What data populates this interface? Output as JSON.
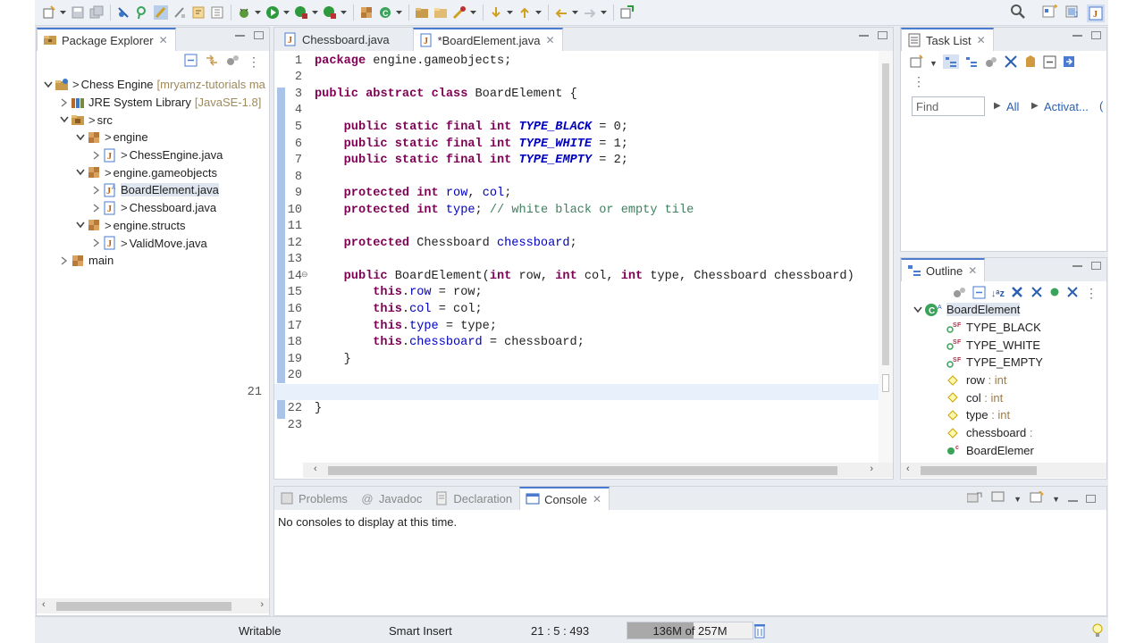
{
  "colors": {
    "accent": "#4a7bd0",
    "keyword": "#7f0055",
    "field": "#0000c0",
    "comment": "#3f7f5f"
  },
  "toolbar": {
    "icons": [
      "new-icon",
      "save-icon",
      "save-all-icon",
      "skip-breakpoints-icon",
      "toggle-mark-occurrences-icon",
      "highlight-icon",
      "block-selection-icon",
      "word-wrap-icon",
      "show-whitespace-icon",
      "debug-icon",
      "run-icon",
      "coverage-icon",
      "external-tools-icon",
      "new-java-package-icon",
      "new-java-class-icon",
      "open-type-icon",
      "open-task-icon",
      "search-icon",
      "next-annotation-icon",
      "previous-annotation-icon",
      "back-icon",
      "forward-icon",
      "pin-editor-icon"
    ]
  },
  "package_explorer": {
    "title": "Package Explorer",
    "tree": [
      {
        "label": "Chess Engine",
        "extra": "[mryamz-tutorials ma",
        "prefix": ">",
        "depth": 0,
        "arrow": "down",
        "icon": "project-icon"
      },
      {
        "label": "JRE System Library",
        "extra": "[JavaSE-1.8]",
        "prefix": "",
        "depth": 1,
        "arrow": "right",
        "icon": "library-icon"
      },
      {
        "label": "src",
        "extra": "",
        "prefix": ">",
        "depth": 1,
        "arrow": "down",
        "icon": "source-folder-icon"
      },
      {
        "label": "engine",
        "extra": "",
        "prefix": ">",
        "depth": 2,
        "arrow": "down",
        "icon": "package-icon"
      },
      {
        "label": "ChessEngine.java",
        "extra": "",
        "prefix": ">",
        "depth": 3,
        "arrow": "right",
        "icon": "java-file-icon"
      },
      {
        "label": "engine.gameobjects",
        "extra": "",
        "prefix": ">",
        "depth": 2,
        "arrow": "down",
        "icon": "package-icon"
      },
      {
        "label": "BoardElement.java",
        "extra": "",
        "prefix": "",
        "depth": 3,
        "arrow": "right",
        "icon": "java-abstract-file-icon",
        "selected": true
      },
      {
        "label": "Chessboard.java",
        "extra": "",
        "prefix": ">",
        "depth": 3,
        "arrow": "right",
        "icon": "java-file-icon"
      },
      {
        "label": "engine.structs",
        "extra": "",
        "prefix": ">",
        "depth": 2,
        "arrow": "down",
        "icon": "package-icon"
      },
      {
        "label": "ValidMove.java",
        "extra": "",
        "prefix": ">",
        "depth": 3,
        "arrow": "right",
        "icon": "java-file-icon"
      },
      {
        "label": "main",
        "extra": "",
        "prefix": "",
        "depth": 1,
        "arrow": "right",
        "icon": "package-icon"
      }
    ]
  },
  "editor": {
    "tabs": [
      {
        "label": "Chessboard.java",
        "active": false
      },
      {
        "label": "*BoardElement.java",
        "active": true
      }
    ],
    "current_line": 21,
    "lines": [
      [
        [
          "kw",
          "package"
        ],
        [
          "t",
          " engine.gameobjects;"
        ]
      ],
      [],
      [
        [
          "kw",
          "public"
        ],
        [
          "t",
          " "
        ],
        [
          "kw",
          "abstract"
        ],
        [
          "t",
          " "
        ],
        [
          "kw",
          "class"
        ],
        [
          "t",
          " BoardElement {"
        ]
      ],
      [],
      [
        [
          "t",
          "    "
        ],
        [
          "kw",
          "public"
        ],
        [
          "t",
          " "
        ],
        [
          "kw",
          "static"
        ],
        [
          "t",
          " "
        ],
        [
          "kw",
          "final"
        ],
        [
          "t",
          " "
        ],
        [
          "kw",
          "int"
        ],
        [
          "t",
          " "
        ],
        [
          "cst",
          "TYPE_BLACK"
        ],
        [
          "t",
          " = 0;"
        ]
      ],
      [
        [
          "t",
          "    "
        ],
        [
          "kw",
          "public"
        ],
        [
          "t",
          " "
        ],
        [
          "kw",
          "static"
        ],
        [
          "t",
          " "
        ],
        [
          "kw",
          "final"
        ],
        [
          "t",
          " "
        ],
        [
          "kw",
          "int"
        ],
        [
          "t",
          " "
        ],
        [
          "cst",
          "TYPE_WHITE"
        ],
        [
          "t",
          " = 1;"
        ]
      ],
      [
        [
          "t",
          "    "
        ],
        [
          "kw",
          "public"
        ],
        [
          "t",
          " "
        ],
        [
          "kw",
          "static"
        ],
        [
          "t",
          " "
        ],
        [
          "kw",
          "final"
        ],
        [
          "t",
          " "
        ],
        [
          "kw",
          "int"
        ],
        [
          "t",
          " "
        ],
        [
          "cst",
          "TYPE_EMPTY"
        ],
        [
          "t",
          " = 2;"
        ]
      ],
      [],
      [
        [
          "t",
          "    "
        ],
        [
          "kw",
          "protected"
        ],
        [
          "t",
          " "
        ],
        [
          "kw",
          "int"
        ],
        [
          "t",
          " "
        ],
        [
          "fld",
          "row"
        ],
        [
          "t",
          ", "
        ],
        [
          "fld",
          "col"
        ],
        [
          "t",
          ";"
        ]
      ],
      [
        [
          "t",
          "    "
        ],
        [
          "kw",
          "protected"
        ],
        [
          "t",
          " "
        ],
        [
          "kw",
          "int"
        ],
        [
          "t",
          " "
        ],
        [
          "fld",
          "type"
        ],
        [
          "t",
          "; "
        ],
        [
          "cmt",
          "// white black or empty tile"
        ]
      ],
      [],
      [
        [
          "t",
          "    "
        ],
        [
          "kw",
          "protected"
        ],
        [
          "t",
          " Chessboard "
        ],
        [
          "fld",
          "chessboard"
        ],
        [
          "t",
          ";"
        ]
      ],
      [],
      [
        [
          "t",
          "    "
        ],
        [
          "kw",
          "public"
        ],
        [
          "t",
          " BoardElement("
        ],
        [
          "kw",
          "int"
        ],
        [
          "t",
          " row, "
        ],
        [
          "kw",
          "int"
        ],
        [
          "t",
          " col, "
        ],
        [
          "kw",
          "int"
        ],
        [
          "t",
          " type, Chessboard chessboard)"
        ]
      ],
      [
        [
          "t",
          "        "
        ],
        [
          "kw",
          "this"
        ],
        [
          "t",
          "."
        ],
        [
          "fld",
          "row"
        ],
        [
          "t",
          " = row;"
        ]
      ],
      [
        [
          "t",
          "        "
        ],
        [
          "kw",
          "this"
        ],
        [
          "t",
          "."
        ],
        [
          "fld",
          "col"
        ],
        [
          "t",
          " = col;"
        ]
      ],
      [
        [
          "t",
          "        "
        ],
        [
          "kw",
          "this"
        ],
        [
          "t",
          "."
        ],
        [
          "fld",
          "type"
        ],
        [
          "t",
          " = type;"
        ]
      ],
      [
        [
          "t",
          "        "
        ],
        [
          "kw",
          "this"
        ],
        [
          "t",
          "."
        ],
        [
          "fld",
          "chessboard"
        ],
        [
          "t",
          " = chessboard;"
        ]
      ],
      [
        [
          "t",
          "    }"
        ]
      ],
      [],
      [],
      [
        [
          "t",
          "}"
        ]
      ],
      []
    ]
  },
  "task_list": {
    "title": "Task List",
    "find_placeholder": "Find",
    "all_label": "All",
    "activate_label": "Activat..."
  },
  "outline": {
    "title": "Outline",
    "items": [
      {
        "label": "BoardElement",
        "type": "",
        "icon": "class-icon",
        "indent": 0,
        "selected": true
      },
      {
        "label": "TYPE_BLACK",
        "type": "",
        "icon": "static-final-field-icon",
        "indent": 1
      },
      {
        "label": "TYPE_WHITE",
        "type": "",
        "icon": "static-final-field-icon",
        "indent": 1
      },
      {
        "label": "TYPE_EMPTY",
        "type": "",
        "icon": "static-final-field-icon",
        "indent": 1
      },
      {
        "label": "row",
        "type": " : int",
        "icon": "protected-field-icon",
        "indent": 1
      },
      {
        "label": "col",
        "type": " : int",
        "icon": "protected-field-icon",
        "indent": 1
      },
      {
        "label": "type",
        "type": " : int",
        "icon": "protected-field-icon",
        "indent": 1
      },
      {
        "label": "chessboard",
        "type": " :",
        "icon": "protected-field-icon",
        "indent": 1
      },
      {
        "label": "BoardElemer",
        "type": "",
        "icon": "constructor-icon",
        "indent": 1
      }
    ]
  },
  "bottom": {
    "tabs": [
      {
        "label": "Problems",
        "icon": "problems-icon",
        "active": false
      },
      {
        "label": "Javadoc",
        "icon": "javadoc-icon",
        "active": false
      },
      {
        "label": "Declaration",
        "icon": "declaration-icon",
        "active": false
      },
      {
        "label": "Console",
        "icon": "console-icon",
        "active": true
      }
    ],
    "console_message": "No consoles to display at this time."
  },
  "status": {
    "writable": "Writable",
    "insert_mode": "Smart Insert",
    "position": "21 : 5 : 493",
    "heap": "136M of 257M",
    "heap_used_fraction": 0.53
  }
}
